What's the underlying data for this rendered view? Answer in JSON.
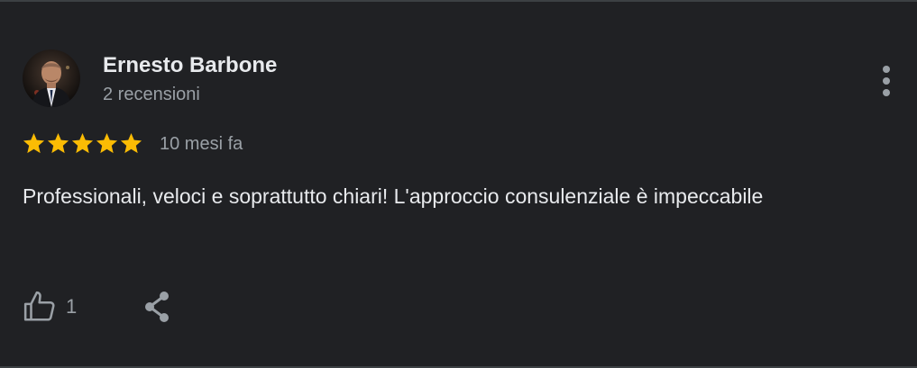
{
  "review": {
    "author_name": "Ernesto Barbone",
    "author_meta": "2 recensioni",
    "rating": 5,
    "max_rating": 5,
    "date": "10 mesi fa",
    "text": "Professionali, veloci e soprattutto chiari! L'approccio consulenziale è impeccabile",
    "like_count": "1"
  },
  "icons": {
    "menu": "more-vertical-icon",
    "like": "thumbs-up-icon",
    "share": "share-icon",
    "star": "star-icon"
  },
  "colors": {
    "background": "#202124",
    "star": "#fbbc04",
    "primary_text": "#e8eaed",
    "secondary_text": "#9aa0a6"
  }
}
